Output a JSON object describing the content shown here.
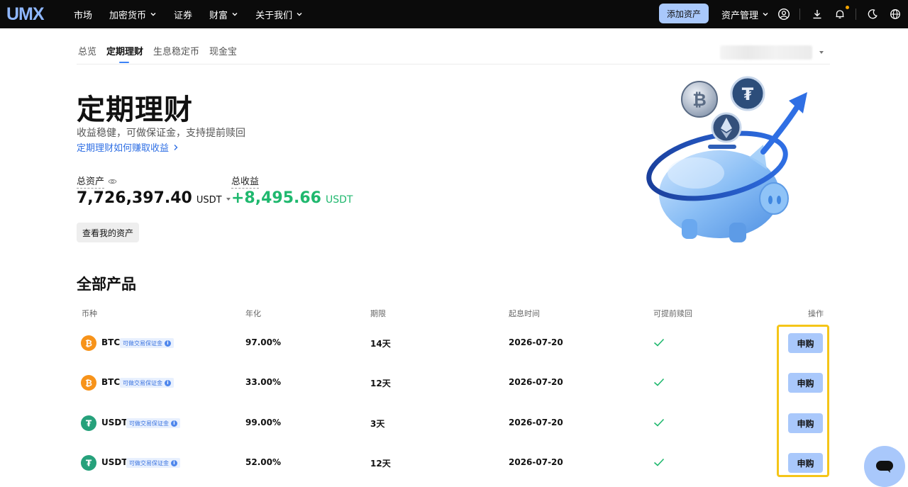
{
  "topbar": {
    "logo": "UMX",
    "nav": [
      {
        "label": "市场",
        "has_dropdown": false
      },
      {
        "label": "加密货币",
        "has_dropdown": true
      },
      {
        "label": "证券",
        "has_dropdown": false
      },
      {
        "label": "财富",
        "has_dropdown": true
      },
      {
        "label": "关于我们",
        "has_dropdown": true
      }
    ],
    "add_asset": "添加资产",
    "asset_mgmt": "资产管理",
    "icons": [
      "user-circle-icon",
      "download-icon",
      "bell-icon",
      "moon-icon",
      "globe-icon"
    ],
    "accent": "#a9c8fb"
  },
  "subtabs": [
    {
      "label": "总览",
      "active": false
    },
    {
      "label": "定期理财",
      "active": true
    },
    {
      "label": "生息稳定币",
      "active": false
    },
    {
      "label": "现金宝",
      "active": false
    }
  ],
  "hero": {
    "title": "定期理财",
    "subtitle": "收益稳健，可做保证金，支持提前赎回",
    "link": "定期理财如何赚取收益"
  },
  "stats": {
    "total_label": "总资产",
    "total_value": "7,726,397.40",
    "total_unit": "USDT",
    "profit_label": "总收益",
    "profit_value": "+8,495.66",
    "profit_unit": "USDT",
    "profit_color": "#1fb86e"
  },
  "view_assets": "查看我的资产",
  "products": {
    "title": "全部产品",
    "columns": [
      "币种",
      "年化",
      "期限",
      "起息时间",
      "可提前赎回",
      "操作"
    ],
    "tag": "可做交易保证金",
    "buy_label": "申购",
    "rows": [
      {
        "coin": "BTC",
        "apy": "97.00%",
        "term": "14天",
        "start": "2026-07-20",
        "early_redeem": true
      },
      {
        "coin": "BTC",
        "apy": "33.00%",
        "term": "12天",
        "start": "2026-07-20",
        "early_redeem": true
      },
      {
        "coin": "USDT",
        "apy": "99.00%",
        "term": "3天",
        "start": "2026-07-20",
        "early_redeem": true
      },
      {
        "coin": "USDT",
        "apy": "52.00%",
        "term": "12天",
        "start": "2026-07-20",
        "early_redeem": true
      }
    ]
  }
}
